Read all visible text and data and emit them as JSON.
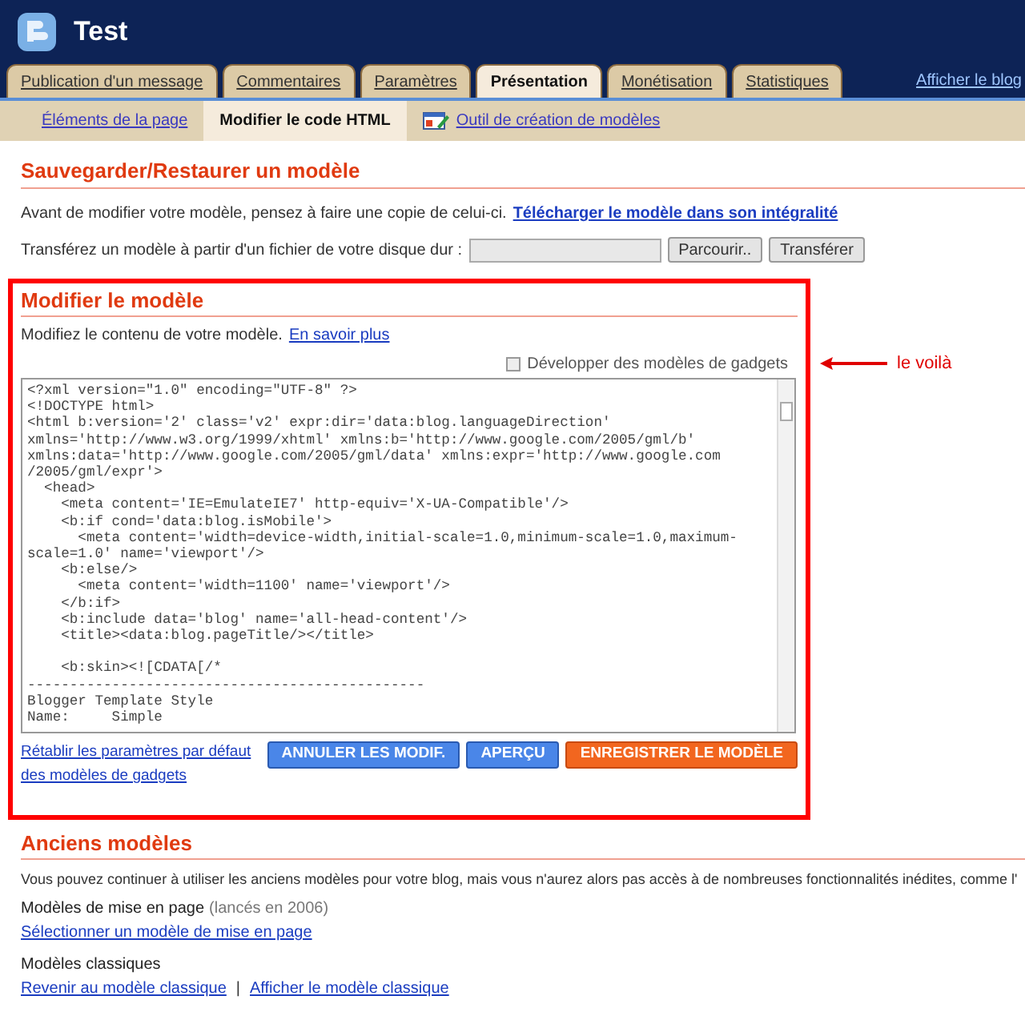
{
  "header": {
    "title": "Test"
  },
  "tabs": [
    {
      "label": "Publication d'un message",
      "selected": false
    },
    {
      "label": "Commentaires",
      "selected": false
    },
    {
      "label": "Paramètres",
      "selected": false
    },
    {
      "label": "Présentation",
      "selected": true
    },
    {
      "label": "Monétisation",
      "selected": false
    },
    {
      "label": "Statistiques",
      "selected": false
    }
  ],
  "view_blog_link": "Afficher le blog",
  "subnav": [
    {
      "label": "Éléments de la page",
      "selected": false,
      "kind": "page"
    },
    {
      "label": "Modifier le code HTML",
      "selected": true,
      "kind": "page"
    },
    {
      "label": "Outil de création de modèles",
      "selected": false,
      "kind": "tool"
    }
  ],
  "save_restore": {
    "title": "Sauvegarder/Restaurer un modèle",
    "intro": "Avant de modifier votre modèle, pensez à faire une copie de celui-ci.",
    "download_link": "Télécharger le modèle dans son intégralité",
    "upload_label": "Transférez un modèle à partir d'un fichier de votre disque dur :",
    "browse_button": "Parcourir..",
    "upload_button": "Transférer"
  },
  "edit": {
    "title": "Modifier le modèle",
    "intro": "Modifiez le contenu de votre modèle.",
    "learn_more_link": "En savoir plus",
    "expand_checkbox": {
      "label": "Développer des modèles de gadgets",
      "checked": false
    },
    "code": "<?xml version=\"1.0\" encoding=\"UTF-8\" ?>\n<!DOCTYPE html>\n<html b:version='2' class='v2' expr:dir='data:blog.languageDirection'\nxmlns='http://www.w3.org/1999/xhtml' xmlns:b='http://www.google.com/2005/gml/b'\nxmlns:data='http://www.google.com/2005/gml/data' xmlns:expr='http://www.google.com\n/2005/gml/expr'>\n  <head>\n    <meta content='IE=EmulateIE7' http-equiv='X-UA-Compatible'/>\n    <b:if cond='data:blog.isMobile'>\n      <meta content='width=device-width,initial-scale=1.0,minimum-scale=1.0,maximum-\nscale=1.0' name='viewport'/>\n    <b:else/>\n      <meta content='width=1100' name='viewport'/>\n    </b:if>\n    <b:include data='blog' name='all-head-content'/>\n    <title><data:blog.pageTitle/></title>\n\n    <b:skin><![CDATA[/*\n-----------------------------------------------\nBlogger Template Style\nName:     Simple",
    "reset_link": "Rétablir les paramètres par défaut des modèles de gadgets",
    "buttons": [
      {
        "label": "ANNULER LES MODIF.",
        "kind": "secondary"
      },
      {
        "label": "APERÇU",
        "kind": "secondary"
      },
      {
        "label": "ENREGISTRER LE MODÈLE",
        "kind": "primary"
      }
    ]
  },
  "annotation": {
    "text": "le voilà"
  },
  "legacy": {
    "title": "Anciens modèles",
    "intro": "Vous pouvez continuer à utiliser les anciens modèles pour votre blog, mais vous n'aurez alors pas accès à de nombreuses fonctionnalités inédites, comme l'",
    "layout_heading": "Modèles de mise en page",
    "layout_note": "(lancés en 2006)",
    "layout_link": "Sélectionner un modèle de mise en page",
    "classic_heading": "Modèles classiques",
    "classic_links": [
      "Revenir au modèle classique",
      "Afficher le modèle classique"
    ],
    "link_separator": "|"
  }
}
